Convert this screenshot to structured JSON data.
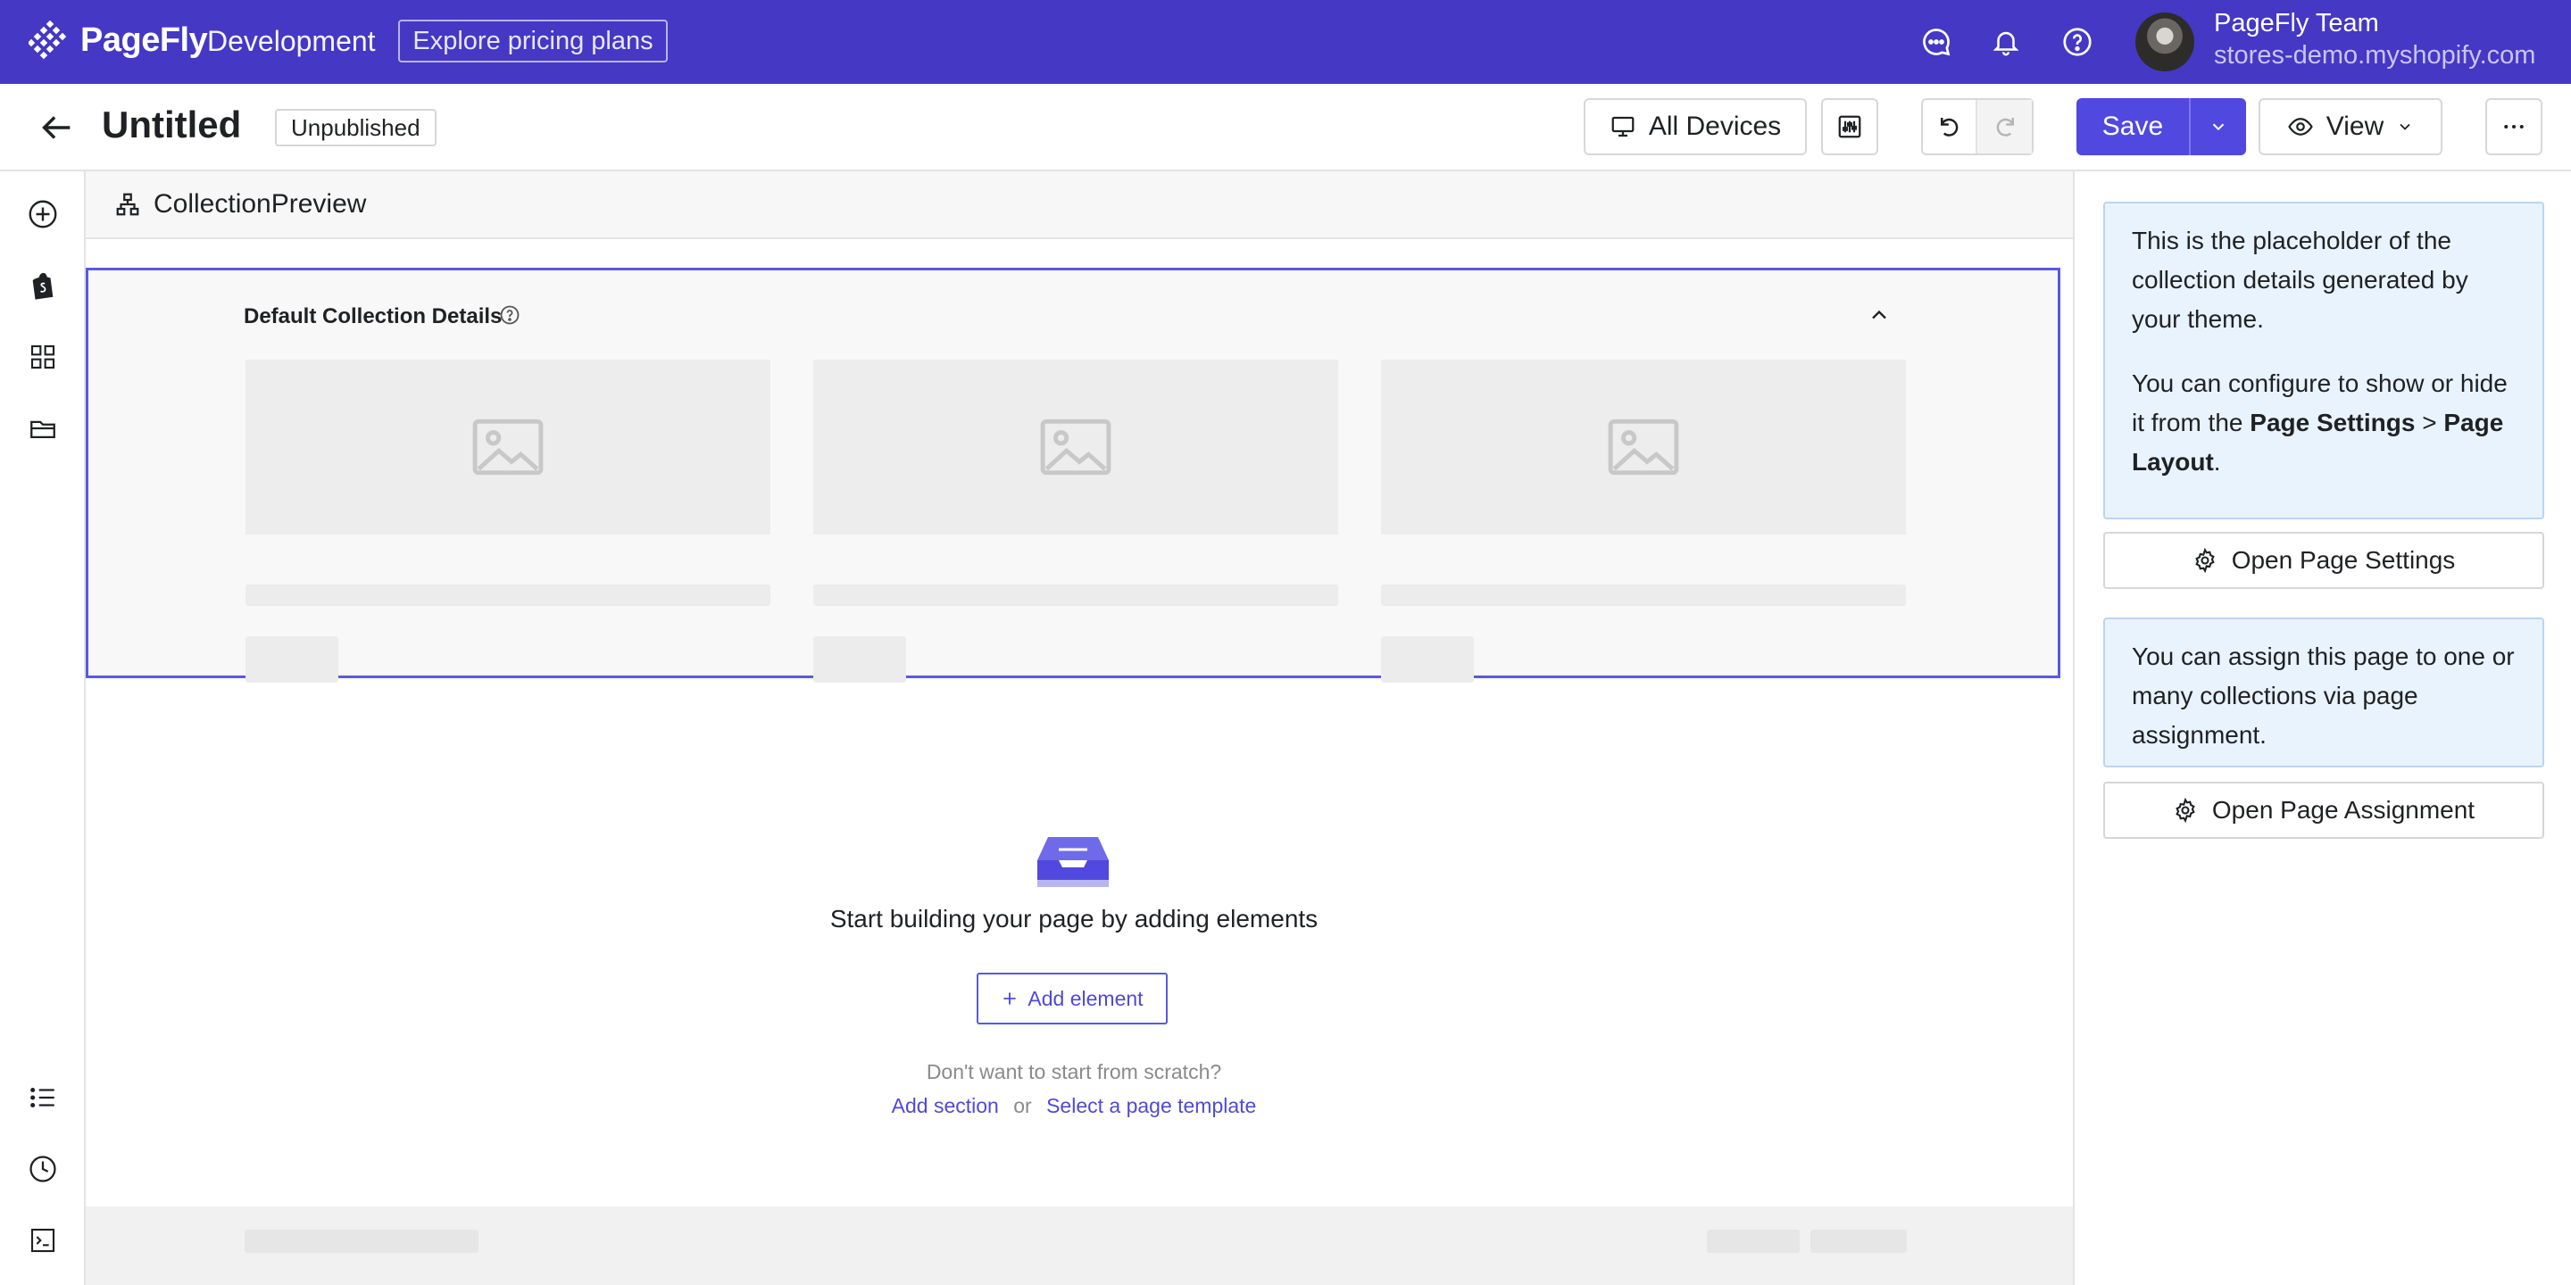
{
  "topbar": {
    "brand": "PageFly",
    "environment": "Development",
    "pricing_button": "Explore pricing plans",
    "account_name": "PageFly Team",
    "account_store": "stores-demo.myshopify.com",
    "icons": [
      "chat-icon",
      "bell-icon",
      "help-icon"
    ]
  },
  "header": {
    "title": "Untitled",
    "status": "Unpublished",
    "devices_label": "All Devices",
    "save_label": "Save",
    "view_label": "View"
  },
  "canvas": {
    "toolbar_label": "CollectionPreview",
    "block_title": "Default Collection Details",
    "empty_title": "Start building your page by adding elements",
    "add_element_label": "Add element",
    "hint": "Don't want to start from scratch?",
    "add_section_link": "Add section",
    "or_text": "or",
    "template_link": "Select a page template"
  },
  "panel": {
    "info1_p1": "This is the placeholder of the collection details generated by your theme.",
    "info1_p2_prefix": "You can configure to show or hide it from the ",
    "info1_p2_bold1": "Page Settings",
    "info1_p2_sep": " > ",
    "info1_p2_bold2": "Page Layout",
    "info1_p2_suffix": ".",
    "open_settings_label": "Open Page Settings",
    "info2": "You can assign this page to one or many collections via page assignment.",
    "open_assignment_label": "Open Page Assignment"
  },
  "colors": {
    "brand": "#4438c4",
    "accent": "#5148e0",
    "selection": "#5b57e6",
    "info_bg": "#e9f3fd"
  }
}
